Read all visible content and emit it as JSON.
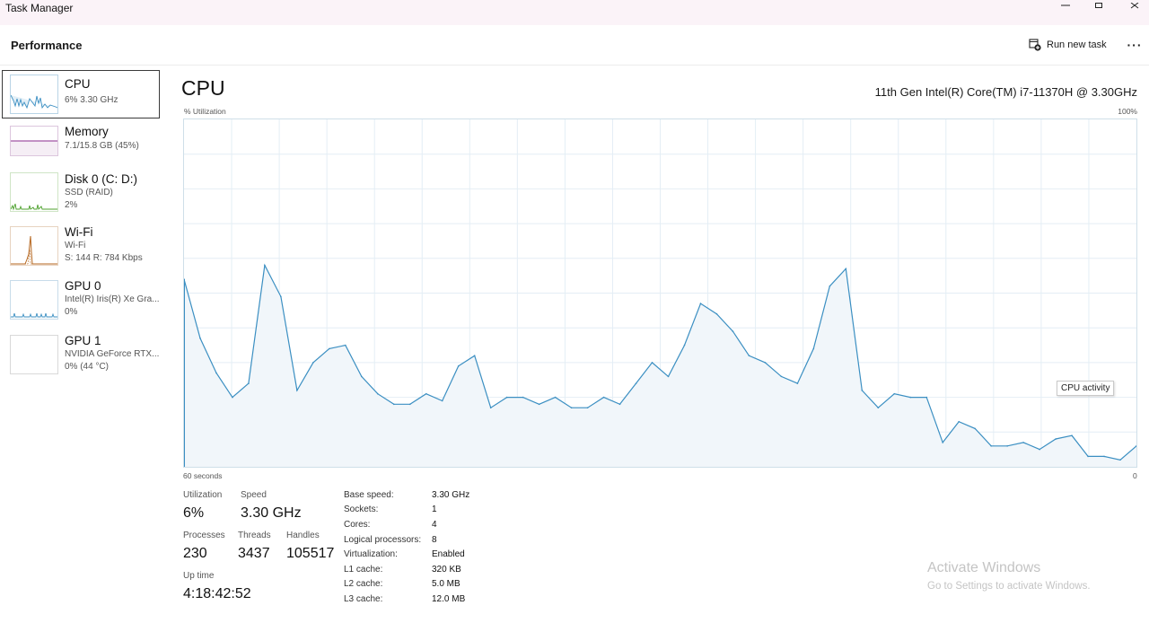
{
  "window": {
    "title": "Task Manager"
  },
  "header": {
    "page": "Performance",
    "run_new_task": "Run new task",
    "more": "···"
  },
  "sidebar": [
    {
      "name": "CPU",
      "line1": "6%  3.30 GHz",
      "line2": "",
      "line3": ""
    },
    {
      "name": "Memory",
      "line1": "7.1/15.8 GB (45%)",
      "line2": "",
      "line3": ""
    },
    {
      "name": "Disk 0 (C: D:)",
      "line1": "SSD (RAID)",
      "line2": "2%",
      "line3": ""
    },
    {
      "name": "Wi-Fi",
      "line1": "Wi-Fi",
      "line2": "S: 144  R: 784 Kbps",
      "line3": ""
    },
    {
      "name": "GPU 0",
      "line1": "Intel(R) Iris(R) Xe Gra...",
      "line2": "0%",
      "line3": ""
    },
    {
      "name": "GPU 1",
      "line1": "NVIDIA GeForce RTX...",
      "line2": "0%  (44 °C)",
      "line3": ""
    }
  ],
  "main": {
    "title": "CPU",
    "model": "11th Gen Intel(R) Core(TM) i7-11370H @ 3.30GHz",
    "utilization_label": "% Utilization",
    "max_label": "100%",
    "time_label": "60 seconds",
    "zero_label": "0",
    "tooltip": "CPU activity"
  },
  "stats": {
    "utilization_label": "Utilization",
    "utilization": "6%",
    "speed_label": "Speed",
    "speed": "3.30 GHz",
    "processes_label": "Processes",
    "processes": "230",
    "threads_label": "Threads",
    "threads": "3437",
    "handles_label": "Handles",
    "handles": "105517",
    "uptime_label": "Up time",
    "uptime": "4:18:42:52"
  },
  "specs": [
    {
      "label": "Base speed:",
      "value": "3.30 GHz"
    },
    {
      "label": "Sockets:",
      "value": "1"
    },
    {
      "label": "Cores:",
      "value": "4"
    },
    {
      "label": "Logical processors:",
      "value": "8"
    },
    {
      "label": "Virtualization:",
      "value": "Enabled"
    },
    {
      "label": "L1 cache:",
      "value": "320 KB"
    },
    {
      "label": "L2 cache:",
      "value": "5.0 MB"
    },
    {
      "label": "L3 cache:",
      "value": "12.0 MB"
    }
  ],
  "watermark": {
    "line1": "Activate Windows",
    "line2": "Go to Settings to activate Windows."
  },
  "colors": {
    "cpu": "#3b8fc2",
    "memory": "#8b2c8f",
    "disk": "#4ca02c",
    "wifi": "#b5651d",
    "gpu": "#3b8fc2"
  },
  "chart_data": {
    "type": "area",
    "title": "CPU",
    "ylabel": "% Utilization",
    "xlabel": "60 seconds",
    "ylim": [
      0,
      100
    ],
    "grid": true,
    "values": [
      54,
      37,
      27,
      20,
      24,
      58,
      49,
      22,
      30,
      34,
      35,
      26,
      21,
      18,
      18,
      21,
      19,
      29,
      32,
      17,
      20,
      20,
      18,
      20,
      17,
      17,
      20,
      18,
      24,
      30,
      26,
      35,
      47,
      44,
      39,
      32,
      30,
      26,
      24,
      34,
      52,
      57,
      22,
      17,
      21,
      20,
      20,
      7,
      13,
      11,
      6,
      6,
      7,
      5,
      8,
      9,
      3,
      3,
      2,
      6
    ]
  }
}
